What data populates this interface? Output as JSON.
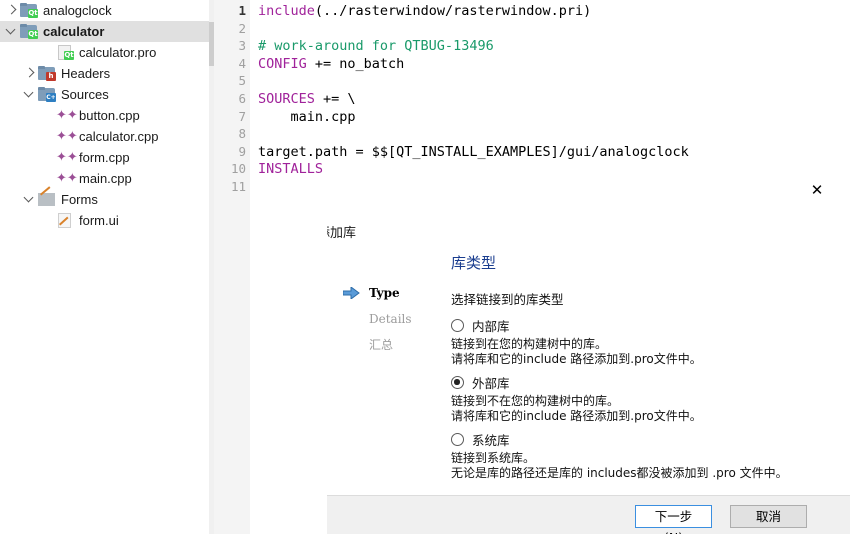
{
  "project_tree": {
    "name": "project-tree",
    "rows": [
      {
        "label": "analogclock",
        "indent": 0,
        "twisty": "collapsed",
        "icon": "qt-folder-icon",
        "bold": false,
        "selected": false
      },
      {
        "label": "calculator",
        "indent": 0,
        "twisty": "expanded",
        "icon": "qt-folder-icon",
        "bold": true,
        "selected": true
      },
      {
        "label": "calculator.pro",
        "indent": 2,
        "twisty": "none",
        "icon": "qt-project-file-icon",
        "bold": false,
        "selected": false
      },
      {
        "label": "Headers",
        "indent": 1,
        "twisty": "collapsed",
        "icon": "headers-folder-icon",
        "bold": false,
        "selected": false
      },
      {
        "label": "Sources",
        "indent": 1,
        "twisty": "expanded",
        "icon": "sources-folder-icon",
        "bold": false,
        "selected": false
      },
      {
        "label": "button.cpp",
        "indent": 2,
        "twisty": "none",
        "icon": "cpp-source-icon",
        "bold": false,
        "selected": false
      },
      {
        "label": "calculator.cpp",
        "indent": 2,
        "twisty": "none",
        "icon": "cpp-source-icon",
        "bold": false,
        "selected": false
      },
      {
        "label": "form.cpp",
        "indent": 2,
        "twisty": "none",
        "icon": "cpp-source-icon",
        "bold": false,
        "selected": false
      },
      {
        "label": "main.cpp",
        "indent": 2,
        "twisty": "none",
        "icon": "cpp-source-icon",
        "bold": false,
        "selected": false
      },
      {
        "label": "Forms",
        "indent": 1,
        "twisty": "expanded",
        "icon": "forms-folder-icon",
        "bold": false,
        "selected": false
      },
      {
        "label": "form.ui",
        "indent": 2,
        "twisty": "none",
        "icon": "ui-file-icon",
        "bold": false,
        "selected": false
      }
    ]
  },
  "editor": {
    "name": "qmake-project-editor",
    "current_line": 1,
    "line_numbers": [
      "1",
      "2",
      "3",
      "4",
      "5",
      "6",
      "7",
      "8",
      "9",
      "10",
      "11"
    ],
    "lines": [
      {
        "n": 1,
        "text": "include(../rasterwindow/rasterwindow.pri)"
      },
      {
        "n": 2,
        "text": ""
      },
      {
        "n": 3,
        "text": "# work-around for QTBUG-13496"
      },
      {
        "n": 4,
        "text": "CONFIG += no_batch"
      },
      {
        "n": 5,
        "text": ""
      },
      {
        "n": 6,
        "text": "SOURCES += \\"
      },
      {
        "n": 7,
        "text": "    main.cpp"
      },
      {
        "n": 8,
        "text": ""
      },
      {
        "n": 9,
        "text": "target.path = $$[QT_INSTALL_EXAMPLES]/gui/analogclock"
      },
      {
        "n": 10,
        "text": "INSTALLS"
      },
      {
        "n": 11,
        "text": ""
      }
    ]
  },
  "dialog": {
    "name": "add-library-wizard",
    "caption": "添加库",
    "close_label": "✕",
    "steps": [
      {
        "label": "Type",
        "active": true
      },
      {
        "label": "Details",
        "active": false
      },
      {
        "label": "汇总",
        "active": false
      }
    ],
    "page": {
      "title": "库类型",
      "subtitle": "选择链接到的库类型",
      "options": [
        {
          "label": "内部库",
          "checked": false,
          "desc_lines": [
            "链接到在您的构建树中的库。",
            "请将库和它的include 路径添加到.pro文件中。"
          ]
        },
        {
          "label": "外部库",
          "checked": true,
          "desc_lines": [
            "链接到不在您的构建树中的库。",
            "请将库和它的include 路径添加到.pro文件中。"
          ]
        },
        {
          "label": "系统库",
          "checked": false,
          "desc_lines": [
            "链接到系统库。",
            "无论是库的路径还是库的 includes都没被添加到 .pro 文件中。"
          ]
        }
      ]
    },
    "buttons": {
      "next": "下一步(N)",
      "cancel": "取消"
    }
  },
  "colors": {
    "selection": "#e0e0e0",
    "wizard_title": "#1a3d8f",
    "primary_button_border": "#3b8fe0",
    "comment": "#1a9a6a",
    "keyword": "#a0229a",
    "qt_green": "#41cd52"
  }
}
